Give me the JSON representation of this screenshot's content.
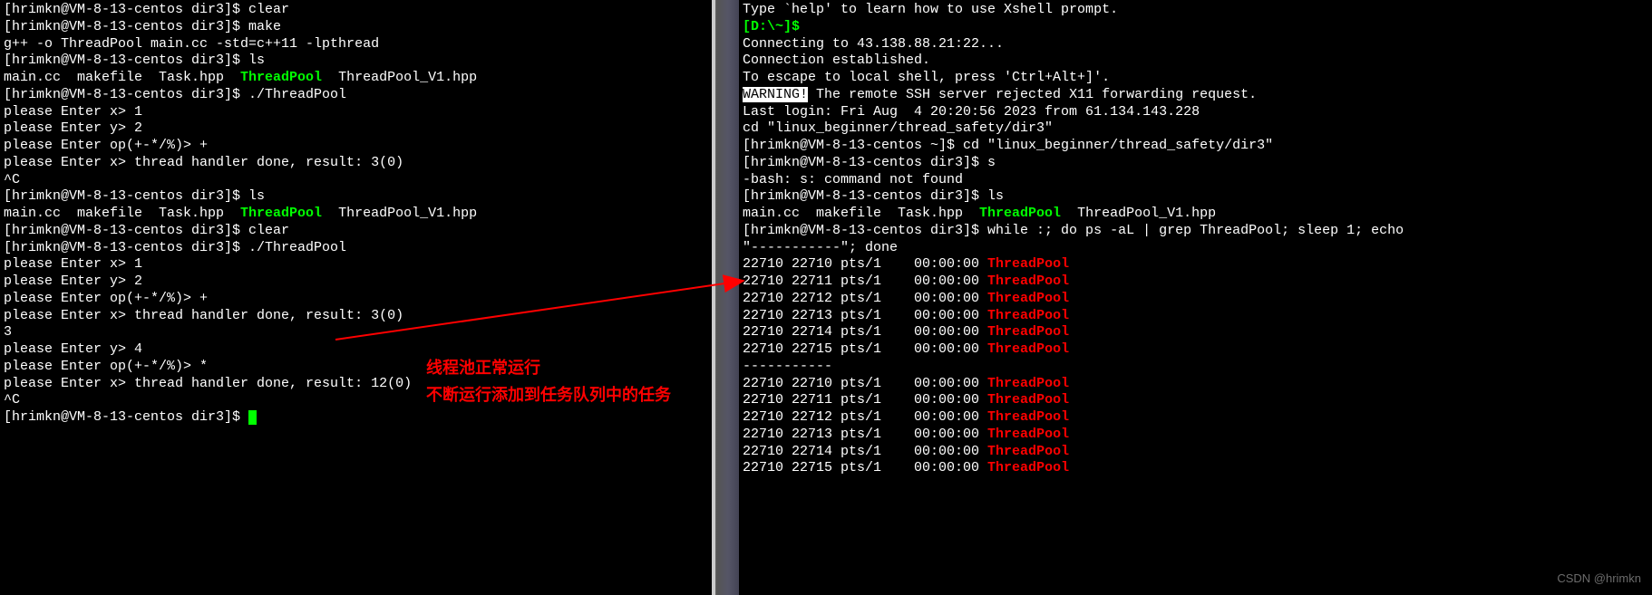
{
  "left": {
    "lines": [
      [
        {
          "t": "[hrimkn@VM-8-13-centos dir3]$ clear"
        }
      ],
      [
        {
          "t": "[hrimkn@VM-8-13-centos dir3]$ make"
        }
      ],
      [
        {
          "t": "g++ -o ThreadPool main.cc -std=c++11 -lpthread"
        }
      ],
      [
        {
          "t": "[hrimkn@VM-8-13-centos dir3]$ ls"
        }
      ],
      [
        {
          "t": "main.cc  makefile  Task.hpp  "
        },
        {
          "t": "ThreadPool",
          "cls": "green"
        },
        {
          "t": "  ThreadPool_V1.hpp"
        }
      ],
      [
        {
          "t": "[hrimkn@VM-8-13-centos dir3]$ ./ThreadPool"
        }
      ],
      [
        {
          "t": "please Enter x> 1"
        }
      ],
      [
        {
          "t": "please Enter y> 2"
        }
      ],
      [
        {
          "t": "please Enter op(+-*/%)> +"
        }
      ],
      [
        {
          "t": "please Enter x> thread handler done, result: 3(0)"
        }
      ],
      [
        {
          "t": "^C"
        }
      ],
      [
        {
          "t": "[hrimkn@VM-8-13-centos dir3]$ ls"
        }
      ],
      [
        {
          "t": "main.cc  makefile  Task.hpp  "
        },
        {
          "t": "ThreadPool",
          "cls": "green"
        },
        {
          "t": "  ThreadPool_V1.hpp"
        }
      ],
      [
        {
          "t": "[hrimkn@VM-8-13-centos dir3]$ clear"
        }
      ],
      [
        {
          "t": "[hrimkn@VM-8-13-centos dir3]$ ./ThreadPool"
        }
      ],
      [
        {
          "t": "please Enter x> 1"
        }
      ],
      [
        {
          "t": "please Enter y> 2"
        }
      ],
      [
        {
          "t": "please Enter op(+-*/%)> +"
        }
      ],
      [
        {
          "t": "please Enter x> thread handler done, result: 3(0)"
        }
      ],
      [
        {
          "t": "3"
        }
      ],
      [
        {
          "t": "please Enter y> 4"
        }
      ],
      [
        {
          "t": "please Enter op(+-*/%)> *"
        }
      ],
      [
        {
          "t": "please Enter x> thread handler done, result: 12(0)"
        }
      ],
      [
        {
          "t": "^C"
        }
      ],
      [
        {
          "t": "[hrimkn@VM-8-13-centos dir3]$ "
        },
        {
          "cursor": true
        }
      ]
    ]
  },
  "right": {
    "lines": [
      [
        {
          "t": ""
        }
      ],
      [
        {
          "t": "Type `help' to learn how to use Xshell prompt."
        }
      ],
      [
        {
          "t": "[D:\\~]$",
          "cls": "green"
        }
      ],
      [
        {
          "t": ""
        }
      ],
      [
        {
          "t": "Connecting to 43.138.88.21:22..."
        }
      ],
      [
        {
          "t": "Connection established."
        }
      ],
      [
        {
          "t": "To escape to local shell, press 'Ctrl+Alt+]'."
        }
      ],
      [
        {
          "t": ""
        }
      ],
      [
        {
          "t": "WARNING!",
          "cls": "warn-inv"
        },
        {
          "t": " The remote SSH server rejected X11 forwarding request."
        }
      ],
      [
        {
          "t": "Last login: Fri Aug  4 20:20:56 2023 from 61.134.143.228"
        }
      ],
      [
        {
          "t": "cd \"linux_beginner/thread_safety/dir3\""
        }
      ],
      [
        {
          "t": "[hrimkn@VM-8-13-centos ~]$ cd \"linux_beginner/thread_safety/dir3\""
        }
      ],
      [
        {
          "t": "[hrimkn@VM-8-13-centos dir3]$ s"
        }
      ],
      [
        {
          "t": "-bash: s: command not found"
        }
      ],
      [
        {
          "t": "[hrimkn@VM-8-13-centos dir3]$ ls"
        }
      ],
      [
        {
          "t": "main.cc  makefile  Task.hpp  "
        },
        {
          "t": "ThreadPool",
          "cls": "green"
        },
        {
          "t": "  ThreadPool_V1.hpp"
        }
      ],
      [
        {
          "t": "[hrimkn@VM-8-13-centos dir3]$ while :; do ps -aL | grep ThreadPool; sleep 1; echo"
        }
      ],
      [
        {
          "t": "\"-----------\"; done"
        }
      ],
      [
        {
          "t": "22710 22710 pts/1    00:00:00 "
        },
        {
          "t": "Thread",
          "cls": "red"
        },
        {
          "t": "Pool",
          "cls": "red"
        }
      ],
      [
        {
          "t": "22710 22711 pts/1    00:00:00 "
        },
        {
          "t": "Thread",
          "cls": "red"
        },
        {
          "t": "Pool",
          "cls": "red"
        }
      ],
      [
        {
          "t": "22710 22712 pts/1    00:00:00 "
        },
        {
          "t": "Thread",
          "cls": "red"
        },
        {
          "t": "Pool",
          "cls": "red"
        }
      ],
      [
        {
          "t": "22710 22713 pts/1    00:00:00 "
        },
        {
          "t": "Thread",
          "cls": "red"
        },
        {
          "t": "Pool",
          "cls": "red"
        }
      ],
      [
        {
          "t": "22710 22714 pts/1    00:00:00 "
        },
        {
          "t": "Thread",
          "cls": "red"
        },
        {
          "t": "Pool",
          "cls": "red"
        }
      ],
      [
        {
          "t": "22710 22715 pts/1    00:00:00 "
        },
        {
          "t": "Thread",
          "cls": "red"
        },
        {
          "t": "Pool",
          "cls": "red"
        }
      ],
      [
        {
          "t": "-----------"
        }
      ],
      [
        {
          "t": "22710 22710 pts/1    00:00:00 "
        },
        {
          "t": "Thread",
          "cls": "red"
        },
        {
          "t": "Pool",
          "cls": "red"
        }
      ],
      [
        {
          "t": "22710 22711 pts/1    00:00:00 "
        },
        {
          "t": "Thread",
          "cls": "red"
        },
        {
          "t": "Pool",
          "cls": "red"
        }
      ],
      [
        {
          "t": "22710 22712 pts/1    00:00:00 "
        },
        {
          "t": "Thread",
          "cls": "red"
        },
        {
          "t": "Pool",
          "cls": "red"
        }
      ],
      [
        {
          "t": "22710 22713 pts/1    00:00:00 "
        },
        {
          "t": "Thread",
          "cls": "red"
        },
        {
          "t": "Pool",
          "cls": "red"
        }
      ],
      [
        {
          "t": "22710 22714 pts/1    00:00:00 "
        },
        {
          "t": "Thread",
          "cls": "red"
        },
        {
          "t": "Pool",
          "cls": "red"
        }
      ],
      [
        {
          "t": "22710 22715 pts/1    00:00:00 "
        },
        {
          "t": "Thread",
          "cls": "red"
        },
        {
          "t": "Pool",
          "cls": "red"
        }
      ]
    ]
  },
  "annotations": {
    "line1": "线程池正常运行",
    "line2": "不断运行添加到任务队列中的任务"
  },
  "watermark": "CSDN @hrimkn"
}
